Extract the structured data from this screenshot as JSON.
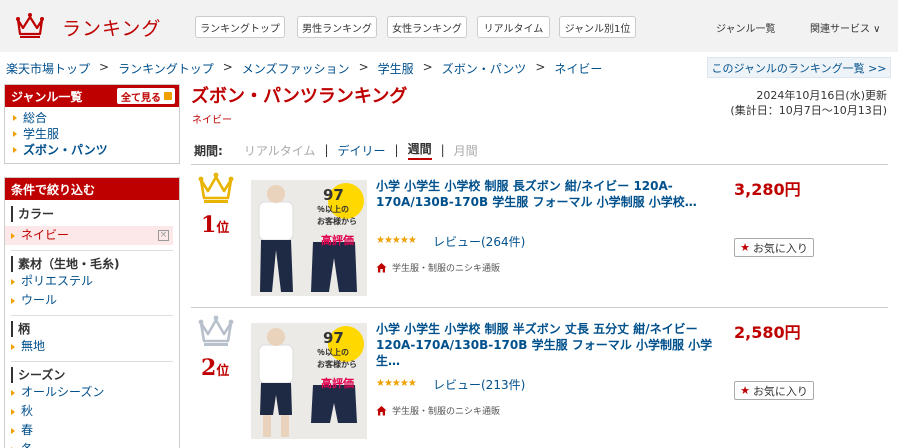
{
  "header": {
    "logo_text": "ランキング",
    "tabs": [
      "ランキングトップ",
      "男性ランキング",
      "女性ランキング",
      "リアルタイム",
      "ジャンル別1位"
    ],
    "genre_list": "ジャンル一覧",
    "related": "関連サービス ∨"
  },
  "breadcrumb": [
    "楽天市場トップ",
    "ランキングトップ",
    "メンズファッション",
    "学生服",
    "ズボン・パンツ",
    "ネイビー"
  ],
  "breadcrumb_sep": ">",
  "genre_ranking_link": "このジャンルのランキング一覧 >>",
  "sidebar": {
    "genre_title": "ジャンル一覧",
    "show_all": "全て見る",
    "genres": [
      "総合",
      "学生服",
      "ズボン・パンツ"
    ],
    "filter_title": "条件で絞り込む",
    "sections": [
      {
        "title": "カラー",
        "items": [
          "ネイビー"
        ]
      },
      {
        "title": "素材（生地・毛糸)",
        "items": [
          "ポリエステル",
          "ウール"
        ]
      },
      {
        "title": "柄",
        "items": [
          "無地"
        ]
      },
      {
        "title": "シーズン",
        "items": [
          "オールシーズン",
          "秋",
          "春",
          "冬"
        ]
      }
    ],
    "clear": "×"
  },
  "main": {
    "title": "ズボン・パンツランキング",
    "subtitle": "ネイビー",
    "updated_line1": "2024年10月16日(水)更新",
    "updated_line2": "(集計日：10月7日～10月13日)",
    "period_label": "期間:",
    "periods": [
      "リアルタイム",
      "デイリー",
      "週間",
      "月間"
    ],
    "period_sep": "|"
  },
  "items": [
    {
      "rank": "1",
      "rank_suffix": "位",
      "title": "小学 小学生 小学校 制服 長ズボン 紺/ネイビー 120A-170A/130B-170B 学生服 フォーマル 小学制服 小学校…",
      "stars": "★★★★★",
      "rating": 4.5,
      "review": "レビュー(264件)",
      "shop": "学生服・制服のニシキ通販",
      "price": "3,280円",
      "fav": "お気に入り",
      "thumb_badge": "97",
      "thumb_line1": "％以上の",
      "thumb_line2": "お客様から",
      "thumb_line3": "高評価"
    },
    {
      "rank": "2",
      "rank_suffix": "位",
      "title": "小学 小学生 小学校 制服 半ズボン 丈長 五分丈 紺/ネイビー 120A-170A/130B-170B 学生服 フォーマル 小学制服 小学生…",
      "stars": "★★★★★",
      "rating": 4.5,
      "review": "レビュー(213件)",
      "shop": "学生服・制服のニシキ通販",
      "price": "2,580円",
      "fav": "お気に入り",
      "thumb_badge": "97",
      "thumb_line1": "％以上の",
      "thumb_line2": "お客様から",
      "thumb_line3": "高評価"
    }
  ],
  "colors": {
    "brand": "#bf0000",
    "link": "#00508c",
    "gold": "#e8b400",
    "silver": "#b8c0cc"
  }
}
